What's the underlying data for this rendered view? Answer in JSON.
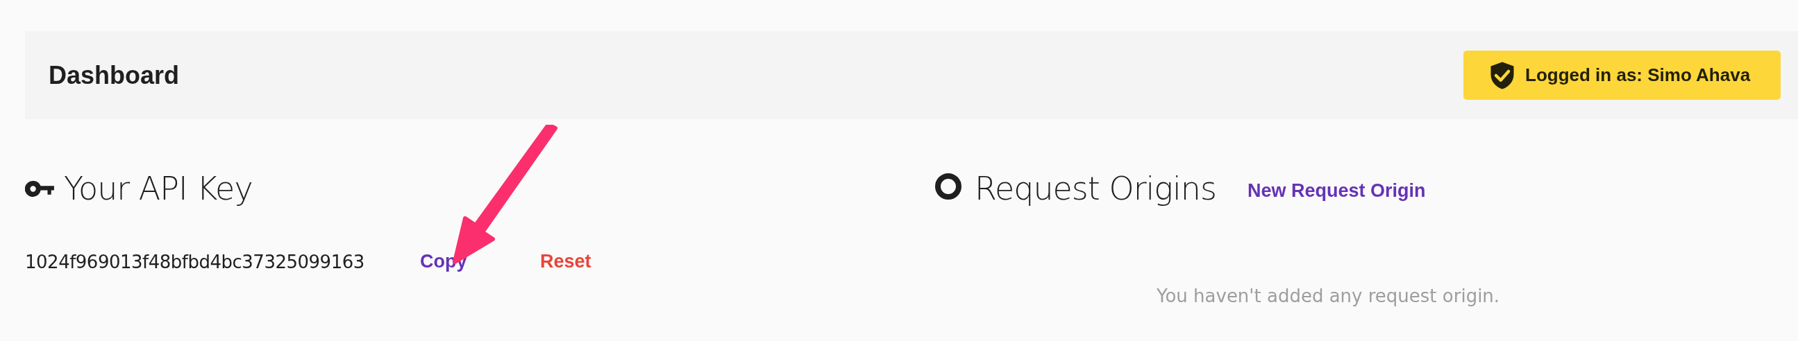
{
  "header": {
    "title": "Dashboard",
    "user_badge": "Logged in as: Simo Ahava"
  },
  "api_key": {
    "heading": "Your API Key",
    "key": "1024f969013f48bfbd4bc37325099163",
    "copy": "Copy",
    "reset": "Reset"
  },
  "request_origins": {
    "heading": "Request Origins",
    "new_link": "New Request Origin",
    "empty_message": "You haven't added any request origin."
  }
}
